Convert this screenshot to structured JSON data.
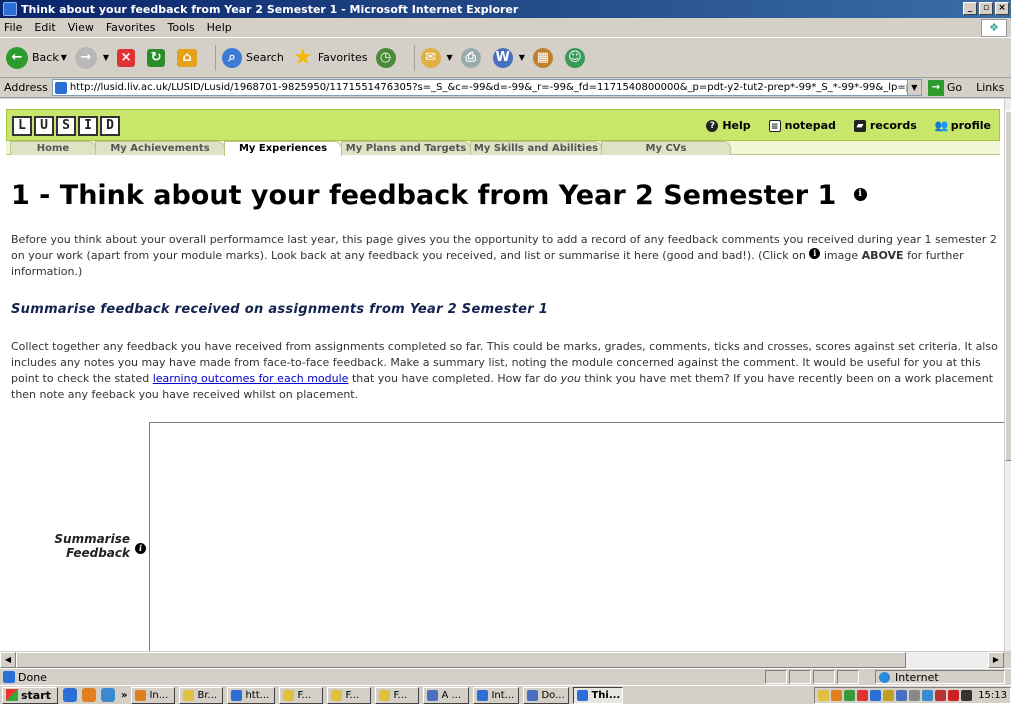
{
  "window": {
    "title": "Think about your feedback from Year 2 Semester 1 - Microsoft Internet Explorer"
  },
  "menu": [
    "File",
    "Edit",
    "View",
    "Favorites",
    "Tools",
    "Help"
  ],
  "toolbar": {
    "back": "Back",
    "search": "Search",
    "favorites": "Favorites"
  },
  "address": {
    "label": "Address",
    "url": "http://lusid.liv.ac.uk/LUSID/Lusid/1968701-9825950/1171551476305?s=_S_&c=-99&d=-99&_r=-99&_fd=1171540800000&_p=pdt-y2-tut2-prep*-99*_S_*-99*-99&_lp=p",
    "go": "Go",
    "links": "Links"
  },
  "lusid": {
    "logo_letters": [
      "L",
      "U",
      "S",
      "I",
      "D"
    ],
    "tools": {
      "help": "Help",
      "notepad": "notepad",
      "records": "records",
      "profile": "profile"
    },
    "tabs": [
      "Home",
      "My Achievements",
      "My Experiences",
      "My Plans and Targets",
      "My Skills and Abilities",
      "My CVs"
    ]
  },
  "page": {
    "title": "1 - Think about your feedback from Year 2 Semester 1",
    "intro": "Before you think about your overall performamce last year, this page gives you the opportunity to add a record of any feedback comments you received during year 1 semester 2 on your work (apart from your module marks). Look back at any feedback you received, and list or summarise it here (good and bad!). (Click on",
    "intro_tail1": "image",
    "intro_above": "ABOVE",
    "intro_tail2": "for further information.)",
    "section_heading": "Summarise feedback received on assignments from Year 2 Semester 1",
    "instructions_a": "Collect together any feedback you have received from assignments completed so far. This could be marks, grades, comments, ticks and crosses, scores against set criteria. It also includes any notes you may have made from face-to-face feedback. Make a summary list, noting the module concerned against the comment. It would be useful for you at this point to check the stated",
    "instructions_link": "learning outcomes for each module",
    "instructions_b": "that you have completed. How far do",
    "instructions_you": "you",
    "instructions_c": "think you have met them? If you have recently been on a work placement then note any feeback you have received whilst on placement.",
    "form_label_line1": "Summarise",
    "form_label_line2": "Feedback",
    "info_glyph": "i"
  },
  "status": {
    "left": "Done",
    "zone": "Internet"
  },
  "taskbar": {
    "start": "start",
    "overflow": "»",
    "tasks": [
      "In...",
      "Br...",
      "htt...",
      "F...",
      "F...",
      "F...",
      "A ...",
      "Int...",
      "Do...",
      "Thi..."
    ],
    "clock": "15:13"
  }
}
